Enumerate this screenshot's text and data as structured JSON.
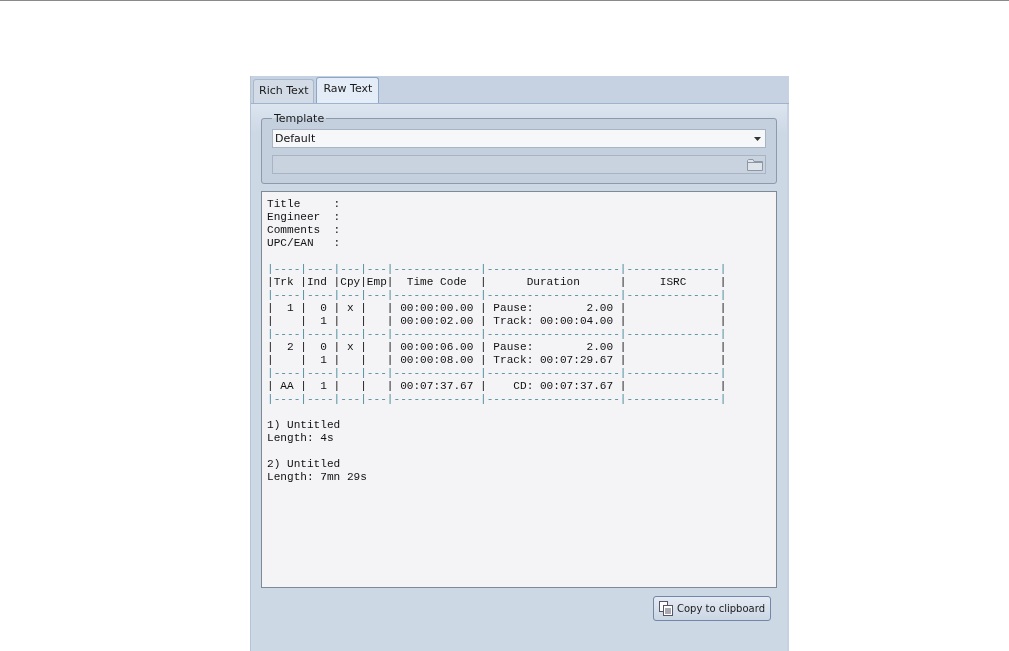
{
  "tabs": [
    {
      "label": "Rich Text",
      "selected": false
    },
    {
      "label": "Raw Text",
      "selected": true
    }
  ],
  "template": {
    "legend": "Template",
    "dropdown": {
      "value": "Default"
    },
    "path_field": {
      "disabled": true
    }
  },
  "raw_text": [
    {
      "kind": "text",
      "text": "Title     :"
    },
    {
      "kind": "text",
      "text": "Engineer  :"
    },
    {
      "kind": "text",
      "text": "Comments  :"
    },
    {
      "kind": "text",
      "text": "UPC/EAN   :"
    },
    {
      "kind": "blank"
    },
    {
      "kind": "rule",
      "text": "|----|----|---|---|-------------|--------------------|--------------|"
    },
    {
      "kind": "text",
      "text": "|Trk |Ind |Cpy|Emp|  Time Code  |      Duration      |     ISRC     |"
    },
    {
      "kind": "rule",
      "text": "|----|----|---|---|-------------|--------------------|--------------|"
    },
    {
      "kind": "text",
      "text": "|  1 |  0 | x |   | 00:00:00.00 | Pause:        2.00 |              |"
    },
    {
      "kind": "text",
      "text": "|    |  1 |   |   | 00:00:02.00 | Track: 00:00:04.00 |              |"
    },
    {
      "kind": "rule",
      "text": "|----|----|---|---|-------------|--------------------|--------------|"
    },
    {
      "kind": "text",
      "text": "|  2 |  0 | x |   | 00:00:06.00 | Pause:        2.00 |              |"
    },
    {
      "kind": "text",
      "text": "|    |  1 |   |   | 00:00:08.00 | Track: 00:07:29.67 |              |"
    },
    {
      "kind": "rule",
      "text": "|----|----|---|---|-------------|--------------------|--------------|"
    },
    {
      "kind": "text",
      "text": "| AA |  1 |   |   | 00:07:37.67 |    CD: 00:07:37.67 |              |"
    },
    {
      "kind": "rule",
      "text": "|----|----|---|---|-------------|--------------------|--------------|"
    },
    {
      "kind": "blank"
    },
    {
      "kind": "text",
      "text": "1) Untitled"
    },
    {
      "kind": "text",
      "text": "Length: 4s"
    },
    {
      "kind": "blank"
    },
    {
      "kind": "text",
      "text": "2) Untitled"
    },
    {
      "kind": "text",
      "text": "Length: 7mn 29s"
    }
  ],
  "copy_button": {
    "label": "Copy to clipboard"
  }
}
